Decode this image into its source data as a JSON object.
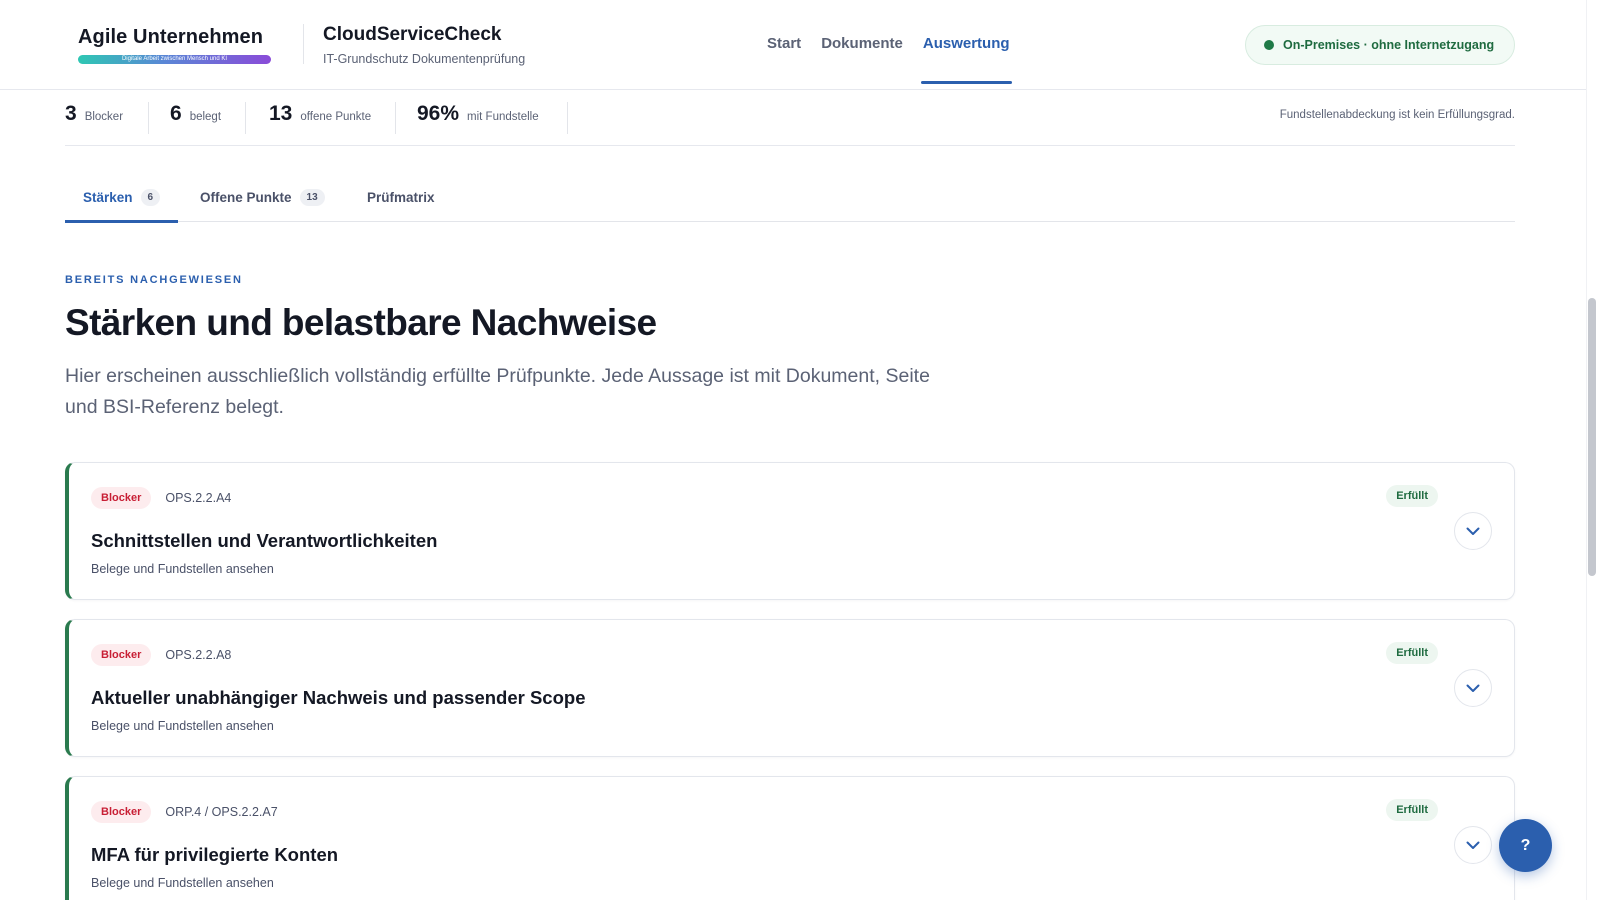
{
  "brand": {
    "name": "Agile Unternehmen",
    "tagline": "Digitale Arbeit zwischen Mensch und KI"
  },
  "product": {
    "name": "CloudServiceCheck",
    "subtitle": "IT-Grundschutz Dokumentenprüfung"
  },
  "nav": {
    "items": [
      {
        "label": "Start",
        "active": false
      },
      {
        "label": "Dokumente",
        "active": false
      },
      {
        "label": "Auswertung",
        "active": true
      }
    ]
  },
  "environment": {
    "label": "On-Premises · ohne Internetzugang",
    "color": "#1f7a47"
  },
  "stats": {
    "items": [
      {
        "value": "3",
        "label": "Blocker"
      },
      {
        "value": "6",
        "label": "belegt"
      },
      {
        "value": "13",
        "label": "offene Punkte"
      },
      {
        "value": "96%",
        "label": "mit Fundstelle"
      }
    ],
    "note": "Fundstellenabdeckung ist kein Erfüllungsgrad."
  },
  "tabs": [
    {
      "label": "Stärken",
      "count": "6",
      "active": true
    },
    {
      "label": "Offene Punkte",
      "count": "13",
      "active": false
    },
    {
      "label": "Prüfmatrix",
      "count": "",
      "active": false
    }
  ],
  "section": {
    "eyebrow": "BEREITS NACHGEWIESEN",
    "title": "Stärken und belastbare Nachweise",
    "description": "Hier erscheinen ausschließlich vollständig erfüllte Prüfpunkte. Jede Aussage ist mit Dokument, Seite und BSI-Referenz belegt."
  },
  "cards": [
    {
      "badge": "Blocker",
      "ref": "OPS.2.2.A4",
      "title": "Schnittstellen und Verantwortlichkeiten",
      "link": "Belege und Fundstellen ansehen",
      "status": "Erfüllt"
    },
    {
      "badge": "Blocker",
      "ref": "OPS.2.2.A8",
      "title": "Aktueller unabhängiger Nachweis und passender Scope",
      "link": "Belege und Fundstellen ansehen",
      "status": "Erfüllt"
    },
    {
      "badge": "Blocker",
      "ref": "ORP.4 / OPS.2.2.A7",
      "title": "MFA für privilegierte Konten",
      "link": "Belege und Fundstellen ansehen",
      "status": "Erfüllt"
    }
  ],
  "help": {
    "label": "?"
  },
  "colors": {
    "accent": "#2b5fae",
    "success": "#1f7a47",
    "danger": "#c81f35"
  }
}
